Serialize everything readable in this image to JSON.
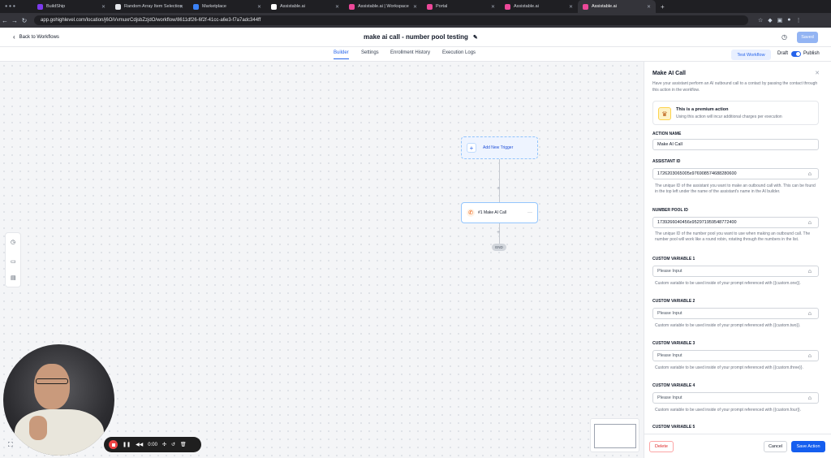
{
  "browser": {
    "tabs": [
      {
        "label": "BuildShip",
        "color": "#7c3aed"
      },
      {
        "label": "Random Array Item Selection",
        "color": "#e5e7eb"
      },
      {
        "label": "Marketplace",
        "color": "#3b82f6"
      },
      {
        "label": "Assistable.ai",
        "color": "#ffffff"
      },
      {
        "label": "Assistable.ai | Workspace",
        "color": "#ec4899"
      },
      {
        "label": "Portal",
        "color": "#ec4899"
      },
      {
        "label": "Assistable.ai",
        "color": "#ec4899"
      },
      {
        "label": "Assistable.ai",
        "color": "#ec4899",
        "active": true
      }
    ],
    "url": "app.gohighlevel.com/location/j6OiVvmuxrCdjsbZzjdO/workflow/8611df26-6f2f-41cc-a6e3-f7a7adc344ff"
  },
  "header": {
    "back_label": "Back to Workflows",
    "workflow_title": "make ai call - number pool testing",
    "saved_label": "Saved"
  },
  "nav": {
    "tabs": [
      {
        "label": "Builder",
        "active": true
      },
      {
        "label": "Settings"
      },
      {
        "label": "Enrollment History"
      },
      {
        "label": "Execution Logs"
      }
    ],
    "test_workflow": "Test Workflow",
    "draft": "Draft",
    "publish": "Publish",
    "published": true
  },
  "canvas": {
    "trigger_label": "Add New Trigger",
    "action_label": "#1 Make AI Call",
    "end_label": "END"
  },
  "recorder": {
    "time": "0:00"
  },
  "panel": {
    "title": "Make AI Call",
    "description": "Have your assistant perform an AI outbound call to a contact by passing the contact through this action in the workflow.",
    "premium_title": "This is a premium action",
    "premium_sub": "Using this action will incur additional charges per execution",
    "action_name_label": "ACTION NAME",
    "action_name_value": "Make AI Call",
    "assistant_id_label": "ASSISTANT ID",
    "assistant_id_value": "1726203065005x976908574688280600",
    "assistant_help": "The unique ID of the assistant you want to make an outbound call with. This can be found in the top left under the name of the assistant's name in the AI builder.",
    "number_pool_label": "NUMBER POOL ID",
    "number_pool_value": "1739266040456x952971959548772400",
    "number_pool_help": "The unique ID of the number pool you want to use when making an outbound call. The number pool will work like a round robin, rotating through the numbers in the list.",
    "custom_vars": [
      {
        "label": "CUSTOM VARIABLE 1",
        "placeholder": "Please Input",
        "help": "Custom variable to be used inside of your prompt referenced with {{custom.one}}."
      },
      {
        "label": "CUSTOM VARIABLE 2",
        "placeholder": "Please Input",
        "help": "Custom variable to be used inside of your prompt referenced with {{custom.two}}."
      },
      {
        "label": "CUSTOM VARIABLE 3",
        "placeholder": "Please Input",
        "help": "Custom variable to be used inside of your prompt referenced with {{custom.three}}."
      },
      {
        "label": "CUSTOM VARIABLE 4",
        "placeholder": "Please Input",
        "help": "Custom variable to be used inside of your prompt referenced with {{custom.four}}."
      },
      {
        "label": "CUSTOM VARIABLE 5"
      }
    ],
    "delete_label": "Delete",
    "cancel_label": "Cancel",
    "save_label": "Save Action"
  }
}
